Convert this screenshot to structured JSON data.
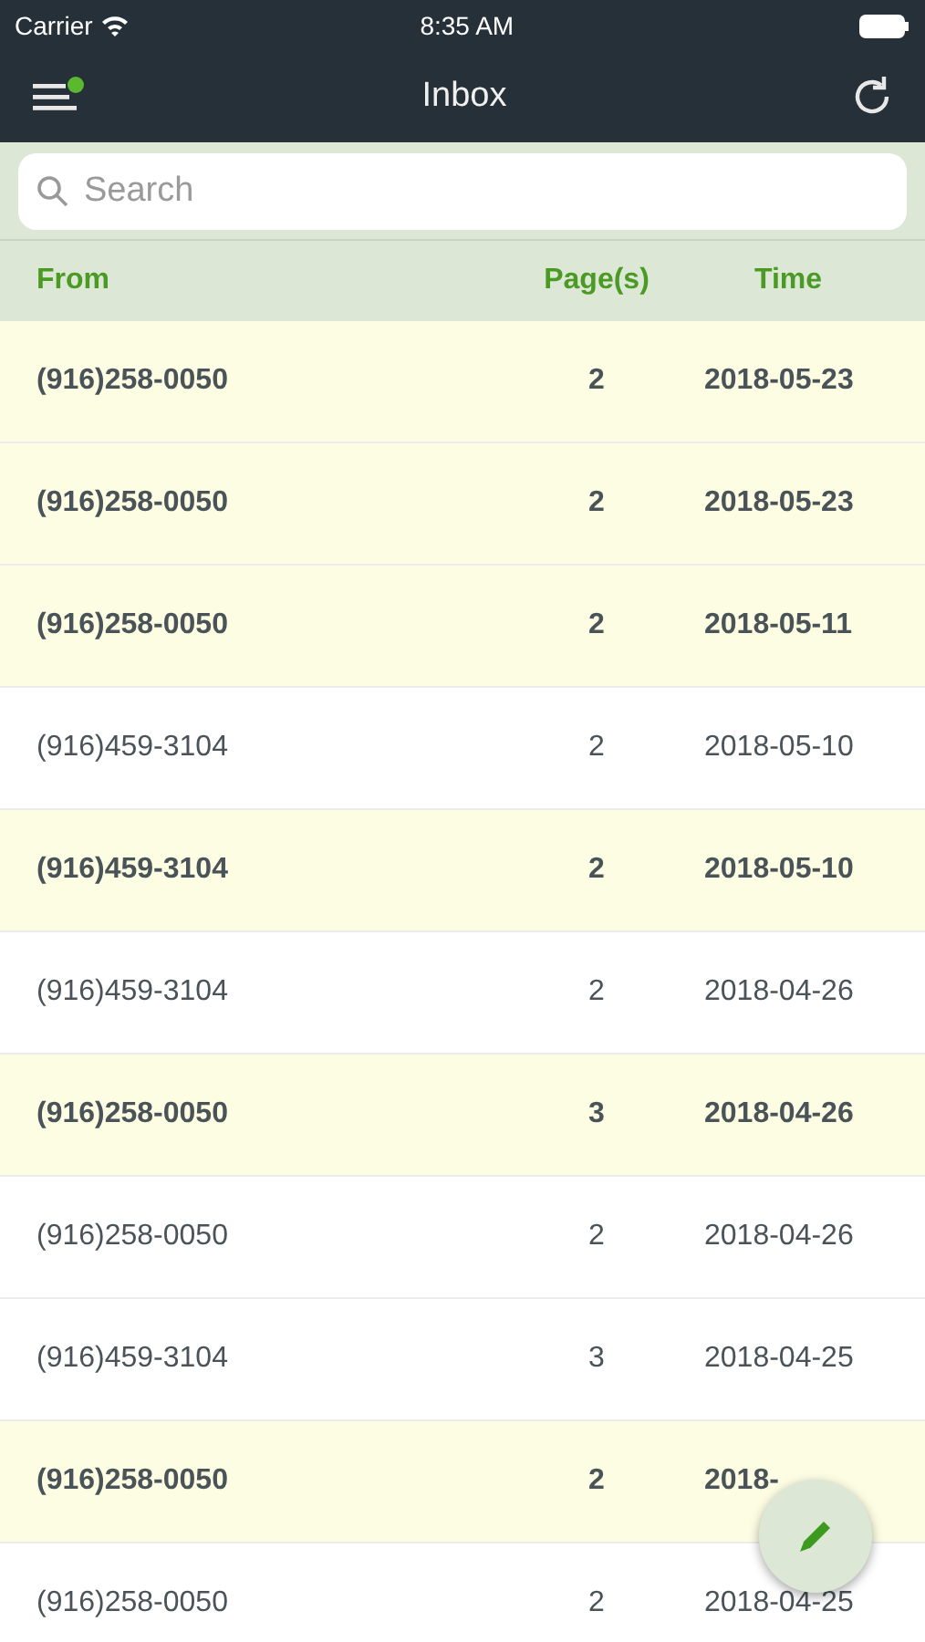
{
  "status_bar": {
    "carrier": "Carrier",
    "time": "8:35 AM"
  },
  "nav": {
    "title": "Inbox",
    "menu_badge": true
  },
  "search": {
    "placeholder": "Search"
  },
  "table": {
    "columns": [
      "From",
      "Page(s)",
      "Time"
    ],
    "rows": [
      {
        "from": "(916)258-0050",
        "pages": "2",
        "time": "2018-05-23",
        "unread": true
      },
      {
        "from": "(916)258-0050",
        "pages": "2",
        "time": "2018-05-23",
        "unread": true
      },
      {
        "from": "(916)258-0050",
        "pages": "2",
        "time": "2018-05-11",
        "unread": true
      },
      {
        "from": "(916)459-3104",
        "pages": "2",
        "time": "2018-05-10",
        "unread": false
      },
      {
        "from": "(916)459-3104",
        "pages": "2",
        "time": "2018-05-10",
        "unread": true
      },
      {
        "from": "(916)459-3104",
        "pages": "2",
        "time": "2018-04-26",
        "unread": false
      },
      {
        "from": "(916)258-0050",
        "pages": "3",
        "time": "2018-04-26",
        "unread": true
      },
      {
        "from": "(916)258-0050",
        "pages": "2",
        "time": "2018-04-26",
        "unread": false
      },
      {
        "from": "(916)459-3104",
        "pages": "3",
        "time": "2018-04-25",
        "unread": false
      },
      {
        "from": "(916)258-0050",
        "pages": "2",
        "time": "2018-",
        "unread": true
      },
      {
        "from": "(916)258-0050",
        "pages": "2",
        "time": "2018-04-25",
        "unread": false
      }
    ]
  }
}
